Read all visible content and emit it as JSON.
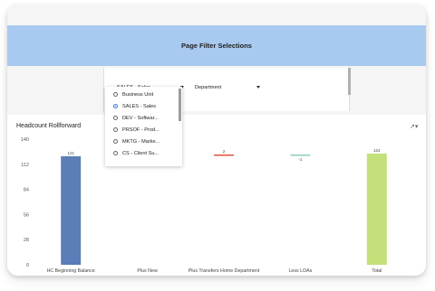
{
  "header": {
    "title": "Page Filter Selections"
  },
  "filters": {
    "primary": {
      "value": "SALES - Sales"
    },
    "secondary": {
      "value": "Department"
    }
  },
  "dropdown": {
    "options": [
      {
        "label": "Business Unit",
        "selected": false
      },
      {
        "label": "SALES - Sales",
        "selected": true
      },
      {
        "label": "DEV - Softwar...",
        "selected": false
      },
      {
        "label": "PRSOF - Prod...",
        "selected": false
      },
      {
        "label": "MKTG - Marke...",
        "selected": false
      },
      {
        "label": "CS - Client Su...",
        "selected": false
      }
    ]
  },
  "chart": {
    "title": "Headcount Rollforward",
    "export_icon": "export-icon"
  },
  "chart_data": {
    "type": "bar",
    "categories": [
      "HC Beginning Balance",
      "Plus New",
      "Plus Transfers Home Department",
      "Less LOAs",
      "Total"
    ],
    "values": [
      121,
      0,
      2,
      -1,
      124
    ],
    "data_labels": [
      "121",
      "",
      "2",
      "-1",
      "124"
    ],
    "ylim": [
      0,
      140
    ],
    "yticks": [
      "0",
      "28",
      "56",
      "84",
      "112",
      "140"
    ],
    "colors": {
      "HC Beginning Balance": "#5b7db8",
      "Plus Transfers Home Department": "#e0574a",
      "Less LOAs": "#8fd0b8",
      "Total": "#c4e07a"
    },
    "grid": false
  }
}
